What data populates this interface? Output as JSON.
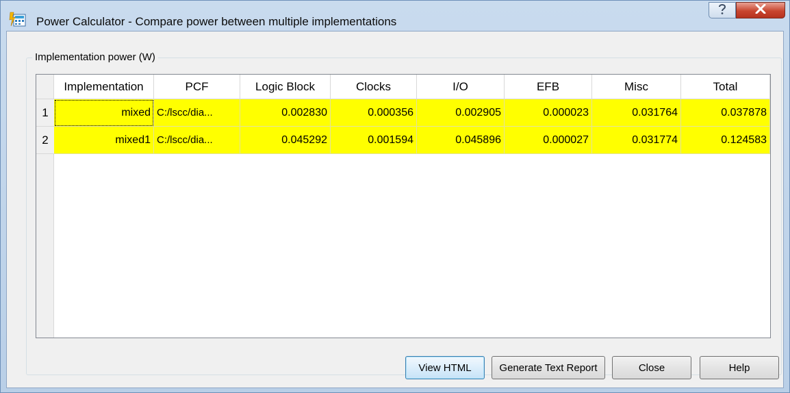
{
  "window": {
    "title": "Power Calculator - Compare power between multiple implementations",
    "icons": {
      "app": "power-calculator-icon",
      "help": "help-icon",
      "close": "close-icon"
    }
  },
  "group": {
    "title": "Implementation power (W)"
  },
  "table": {
    "columns": [
      "Implementation",
      "PCF",
      "Logic Block",
      "Clocks",
      "I/O",
      "EFB",
      "Misc",
      "Total"
    ],
    "rows": [
      {
        "index": "1",
        "implementation": "mixed",
        "pcf": "C:/lscc/dia...",
        "logic_block": "0.002830",
        "clocks": "0.000356",
        "io": "0.002905",
        "efb": "0.000023",
        "misc": "0.031764",
        "total": "0.037878"
      },
      {
        "index": "2",
        "implementation": "mixed1",
        "pcf": "C:/lscc/dia...",
        "logic_block": "0.045292",
        "clocks": "0.001594",
        "io": "0.045896",
        "efb": "0.000027",
        "misc": "0.031774",
        "total": "0.124583"
      }
    ],
    "highlight_color": "#ffff00"
  },
  "buttons": {
    "view_html": "View HTML",
    "generate_text_report": "Generate Text Report",
    "close": "Close",
    "help": "Help"
  }
}
